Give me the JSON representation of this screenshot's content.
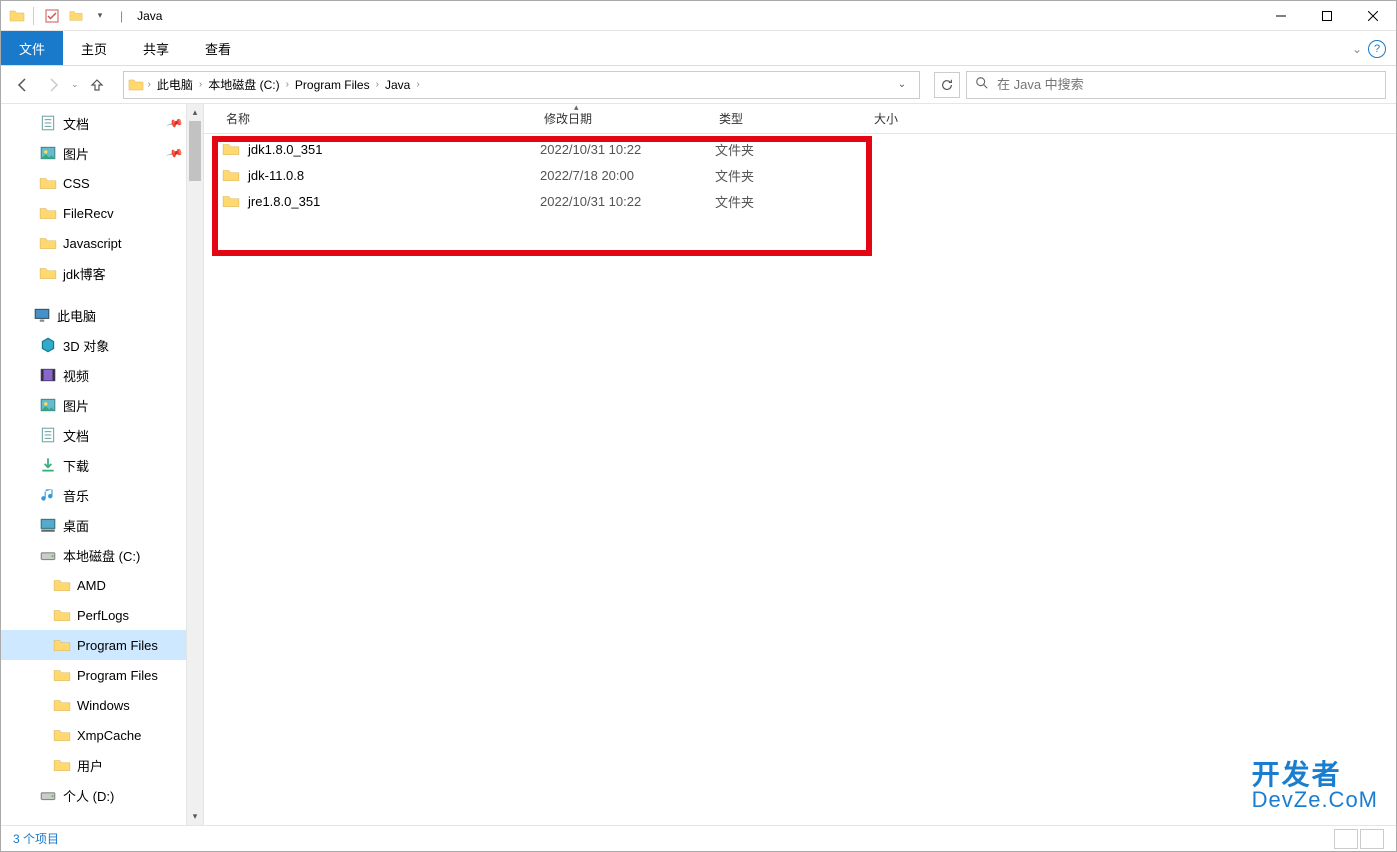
{
  "window": {
    "title": "Java"
  },
  "ribbon": {
    "tabs": [
      "文件",
      "主页",
      "共享",
      "查看"
    ]
  },
  "nav": {
    "breadcrumb": [
      "此电脑",
      "本地磁盘 (C:)",
      "Program Files",
      "Java"
    ]
  },
  "search": {
    "placeholder": "在 Java 中搜索"
  },
  "columns": {
    "name": "名称",
    "date": "修改日期",
    "type": "类型",
    "size": "大小"
  },
  "sidebar": {
    "quick": [
      {
        "label": "文档",
        "icon": "doc",
        "pin": true
      },
      {
        "label": "图片",
        "icon": "pic",
        "pin": true
      },
      {
        "label": "CSS",
        "icon": "folder"
      },
      {
        "label": "FileRecv",
        "icon": "folder"
      },
      {
        "label": "Javascript",
        "icon": "folder"
      },
      {
        "label": "jdk博客",
        "icon": "folder"
      }
    ],
    "thispc_label": "此电脑",
    "thispc": [
      {
        "label": "3D 对象",
        "icon": "3d"
      },
      {
        "label": "视频",
        "icon": "video"
      },
      {
        "label": "图片",
        "icon": "pic"
      },
      {
        "label": "文档",
        "icon": "doc"
      },
      {
        "label": "下载",
        "icon": "download"
      },
      {
        "label": "音乐",
        "icon": "music"
      },
      {
        "label": "桌面",
        "icon": "desktop"
      },
      {
        "label": "本地磁盘 (C:)",
        "icon": "drive"
      }
    ],
    "cdrive": [
      {
        "label": "AMD"
      },
      {
        "label": "PerfLogs"
      },
      {
        "label": "Program Files",
        "selected": true
      },
      {
        "label": "Program Files"
      },
      {
        "label": "Windows"
      },
      {
        "label": "XmpCache"
      },
      {
        "label": "用户"
      }
    ],
    "ddrive": {
      "label": "个人 (D:)",
      "icon": "drive"
    }
  },
  "files": [
    {
      "name": "jdk1.8.0_351",
      "date": "2022/10/31 10:22",
      "type": "文件夹"
    },
    {
      "name": "jdk-11.0.8",
      "date": "2022/7/18 20:00",
      "type": "文件夹"
    },
    {
      "name": "jre1.8.0_351",
      "date": "2022/10/31 10:22",
      "type": "文件夹"
    }
  ],
  "status": {
    "text": "3 个项目"
  },
  "watermark": {
    "line1": "开发者",
    "line2": "DevZe.CoM"
  }
}
